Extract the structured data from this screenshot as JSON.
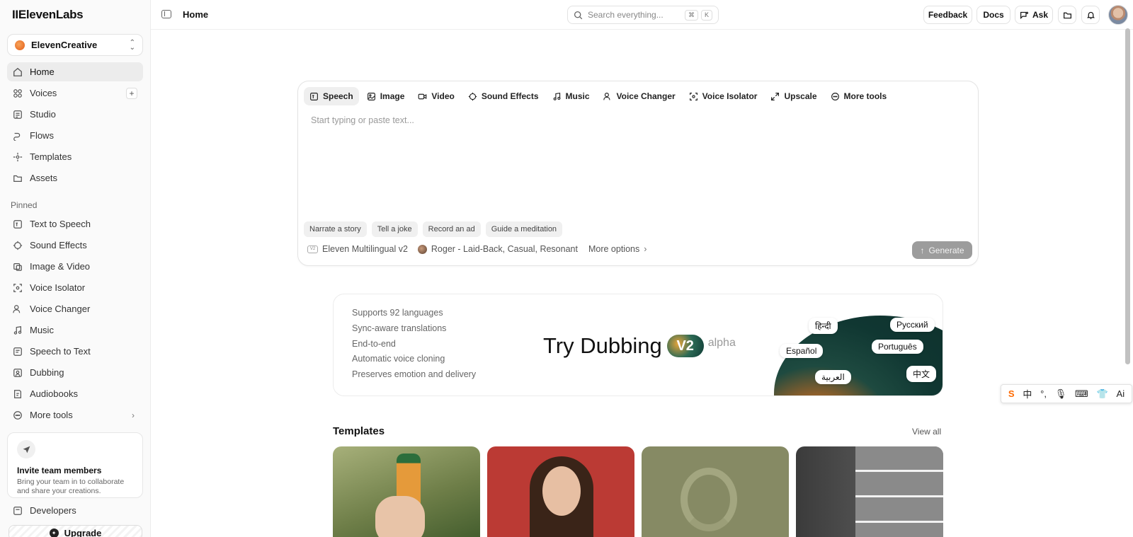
{
  "sidebar": {
    "logo": "IIElevenLabs",
    "workspace": "ElevenCreative",
    "nav": [
      {
        "label": "Home"
      },
      {
        "label": "Voices"
      },
      {
        "label": "Studio"
      },
      {
        "label": "Flows"
      },
      {
        "label": "Templates"
      },
      {
        "label": "Assets"
      }
    ],
    "pinned_label": "Pinned",
    "pinned": [
      {
        "label": "Text to Speech"
      },
      {
        "label": "Sound Effects"
      },
      {
        "label": "Image & Video"
      },
      {
        "label": "Voice Isolator"
      },
      {
        "label": "Voice Changer"
      },
      {
        "label": "Music"
      },
      {
        "label": "Speech to Text"
      },
      {
        "label": "Dubbing"
      },
      {
        "label": "Audiobooks"
      },
      {
        "label": "More tools"
      }
    ],
    "invite": {
      "title": "Invite team members",
      "subtitle": "Bring your team in to collaborate and share your creations."
    },
    "developers": "Developers",
    "upgrade": "Upgrade"
  },
  "header": {
    "breadcrumb": "Home",
    "search_placeholder": "Search everything...",
    "search_keys": [
      "⌘",
      "K"
    ],
    "feedback": "Feedback",
    "docs": "Docs",
    "ask": "Ask"
  },
  "composer": {
    "tabs": [
      {
        "label": "Speech",
        "icon": "speech-icon"
      },
      {
        "label": "Image",
        "icon": "image-icon"
      },
      {
        "label": "Video",
        "icon": "video-icon"
      },
      {
        "label": "Sound Effects",
        "icon": "sound-effects-icon"
      },
      {
        "label": "Music",
        "icon": "music-icon"
      },
      {
        "label": "Voice Changer",
        "icon": "voice-changer-icon"
      },
      {
        "label": "Voice Isolator",
        "icon": "voice-isolator-icon"
      },
      {
        "label": "Upscale",
        "icon": "upscale-icon"
      },
      {
        "label": "More tools",
        "icon": "more-tools-icon"
      }
    ],
    "placeholder": "Start typing or paste text...",
    "chips": [
      "Narrate a story",
      "Tell a joke",
      "Record an ad",
      "Guide a meditation"
    ],
    "model_badge": "V2",
    "model": "Eleven Multilingual v2",
    "voice": "Roger - Laid-Back, Casual, Resonant",
    "more_options": "More options",
    "generate": "Generate"
  },
  "dubbing": {
    "features": [
      "Supports 92 languages",
      "Sync-aware translations",
      "End-to-end",
      "Automatic voice cloning",
      "Preserves emotion and delivery"
    ],
    "title": "Try Dubbing",
    "badge": "V2",
    "tag": "alpha",
    "languages": [
      "हिन्दी",
      "Русский",
      "Español",
      "Português",
      "العربية",
      "中文"
    ]
  },
  "templates": {
    "title": "Templates",
    "view_all": "View all"
  },
  "ime": {
    "items": [
      "中"
    ]
  }
}
